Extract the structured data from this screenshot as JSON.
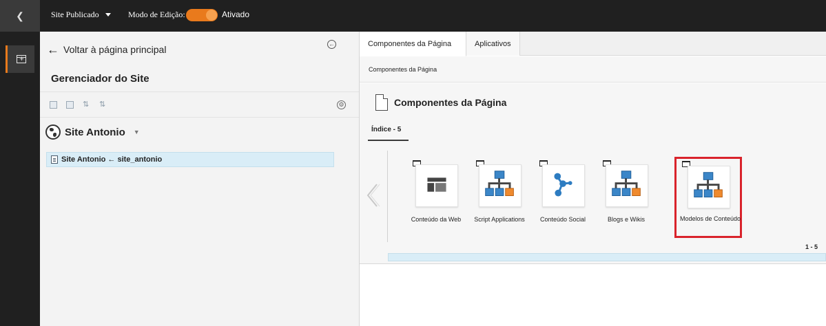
{
  "topbar": {
    "back_icon": "chevron-left",
    "published_label": "Site Publicado",
    "edit_mode_label": "Modo de Edição:",
    "edit_mode_state": "Ativado",
    "toggle_color": "#e97a1c"
  },
  "leftrail": {
    "add_icon": "add-component-icon"
  },
  "site_manager": {
    "back_link": "Voltar à página principal",
    "title": "Gerenciador do Site",
    "site_name": "Site Antonio",
    "tree_item": "Site Antonio ← site_antonio"
  },
  "right_panel": {
    "tabs": [
      {
        "label": "Componentes da Página",
        "active": true
      },
      {
        "label": "Aplicativos",
        "active": false
      }
    ],
    "breadcrumb": "Componentes da Página",
    "header_title": "Componentes da Página",
    "index_tab": "Índice - 5",
    "items": [
      {
        "label": "Conteúdo da Web",
        "icon": "web-content-icon"
      },
      {
        "label": "Script Applications",
        "icon": "hierarchy-icon"
      },
      {
        "label": "Conteúdo Social",
        "icon": "social-icon"
      },
      {
        "label": "Blogs e Wikis",
        "icon": "hierarchy-icon"
      },
      {
        "label": "Modelos de Conteúdo",
        "icon": "hierarchy-icon",
        "highlighted": true
      }
    ],
    "pager": "1 - 5",
    "highlight_color": "#d9232b"
  }
}
